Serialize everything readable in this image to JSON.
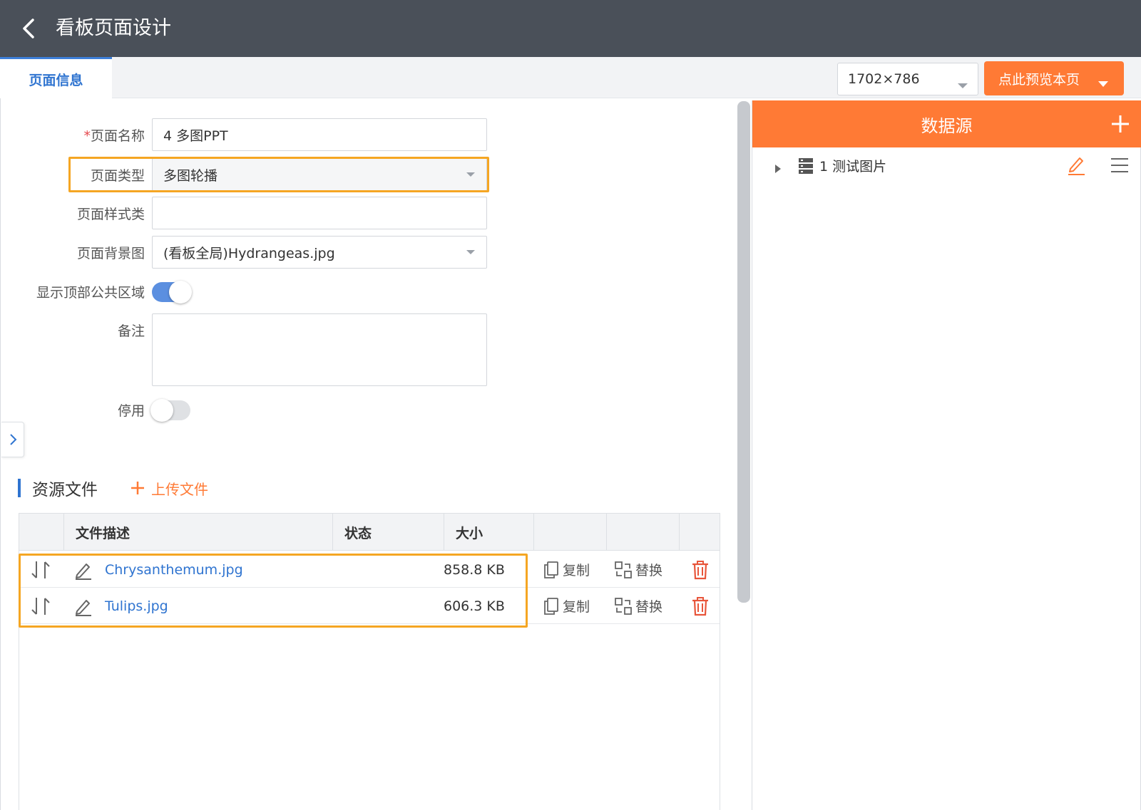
{
  "header": {
    "title": "看板页面设计"
  },
  "tabs": [
    {
      "label": "页面信息"
    }
  ],
  "toolbar": {
    "size_value": "1702×786",
    "preview_label": "点此预览本页"
  },
  "form": {
    "page_name_label": "页面名称",
    "page_name_value": "4 多图PPT",
    "page_type_label": "页面类型",
    "page_type_value": "多图轮播",
    "page_style_label": "页面样式类",
    "page_style_value": "",
    "page_bg_label": "页面背景图",
    "page_bg_value": "(看板全局)Hydrangeas.jpg",
    "show_top_label": "显示顶部公共区域",
    "show_top_on": true,
    "remark_label": "备注",
    "remark_value": "",
    "disable_label": "停用",
    "disable_on": false
  },
  "resources": {
    "title": "资源文件",
    "upload_label": "上传文件",
    "columns": [
      "",
      "文件描述",
      "状态",
      "大小",
      "",
      "",
      ""
    ],
    "rows": [
      {
        "name": "Chrysanthemum.jpg",
        "status": "",
        "size": "858.8 KB",
        "copy": "复制",
        "replace": "替换"
      },
      {
        "name": "Tulips.jpg",
        "status": "",
        "size": "606.3 KB",
        "copy": "复制",
        "replace": "替换"
      }
    ]
  },
  "datasource": {
    "title": "数据源",
    "items": [
      {
        "label": "1 测试图片"
      }
    ]
  },
  "colors": {
    "accent": "#ff7a35",
    "primary": "#2f74d0",
    "header_bg": "#4a5059",
    "highlight": "#f5a623"
  }
}
